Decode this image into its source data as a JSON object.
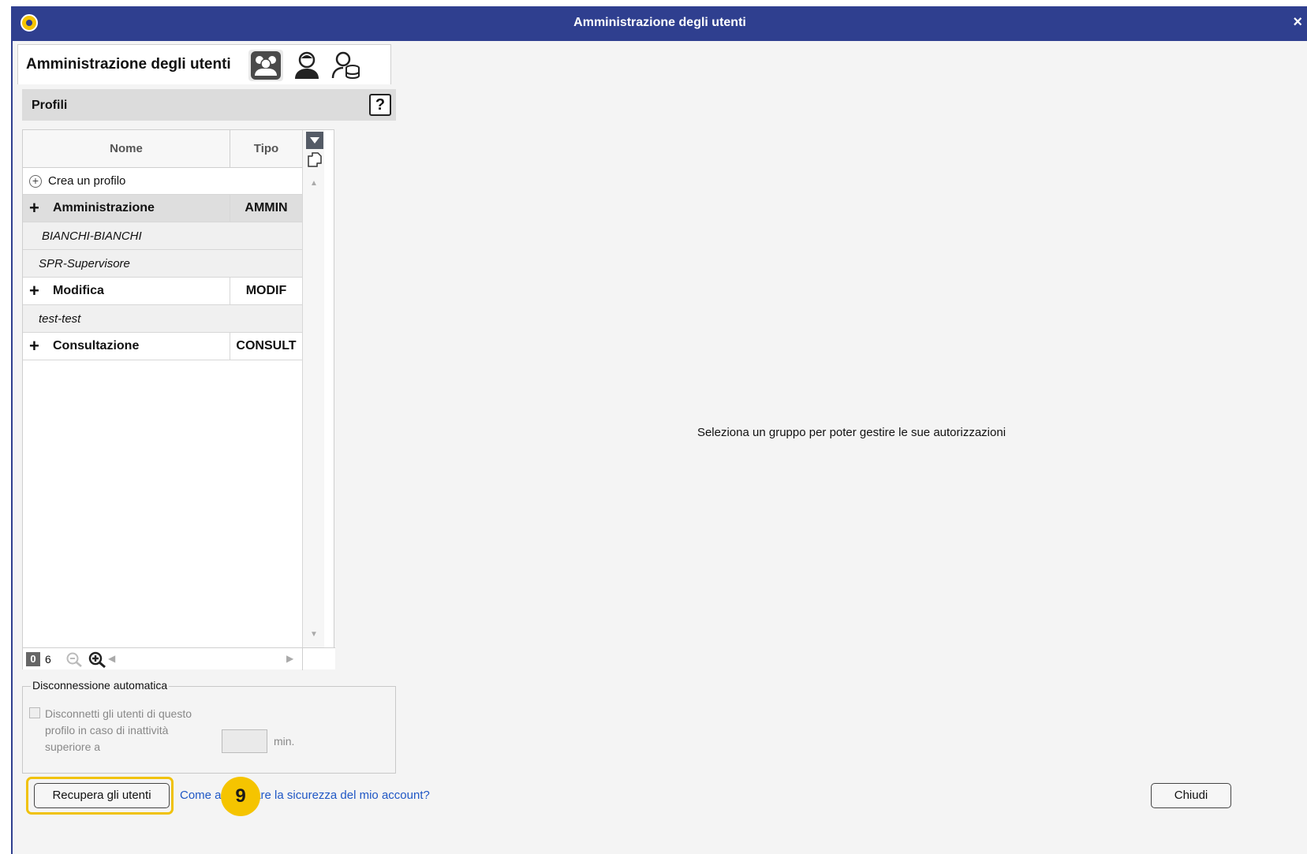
{
  "window": {
    "title": "Amministrazione degli utenti",
    "close_label": "×"
  },
  "tabbar": {
    "title": "Amministrazione degli utenti",
    "icons": [
      "groups-icon",
      "user-icon",
      "user-database-icon"
    ],
    "active_icon": "groups-icon"
  },
  "section": {
    "title": "Profili",
    "help_label": "?"
  },
  "grid": {
    "columns": {
      "name": "Nome",
      "type": "Tipo"
    },
    "create_label": "Crea un profilo",
    "rows": [
      {
        "kind": "group",
        "name": "Amministrazione",
        "type": "AMMIN",
        "selected": true
      },
      {
        "kind": "user",
        "name": "BIANCHI-BIANCHI"
      },
      {
        "kind": "user",
        "name": "SPR-Supervisore"
      },
      {
        "kind": "group",
        "name": "Modifica",
        "type": "MODIF",
        "selected": false
      },
      {
        "kind": "user",
        "name": "test-test"
      },
      {
        "kind": "group",
        "name": "Consultazione",
        "type": "CONSULT",
        "selected": false
      }
    ],
    "footer": {
      "selected_count": "0",
      "total_count": "6"
    }
  },
  "auto_disconnect": {
    "legend": "Disconnessione automatica",
    "checkbox_label": "Disconnetti gli utenti di questo profilo in caso di inattività superiore a",
    "minutes_value": "",
    "unit": "min."
  },
  "main": {
    "message": "Seleziona un gruppo per poter gestire le sue autorizzazioni"
  },
  "footer": {
    "recover_button": "Recupera gli utenti",
    "help_link": "Come aumentare la sicurezza del mio account?",
    "close_button": "Chiudi",
    "step_badge": "9"
  },
  "colors": {
    "titlebar": "#2f3f8f",
    "highlight": "#f0c20a",
    "link": "#1f57c5"
  }
}
